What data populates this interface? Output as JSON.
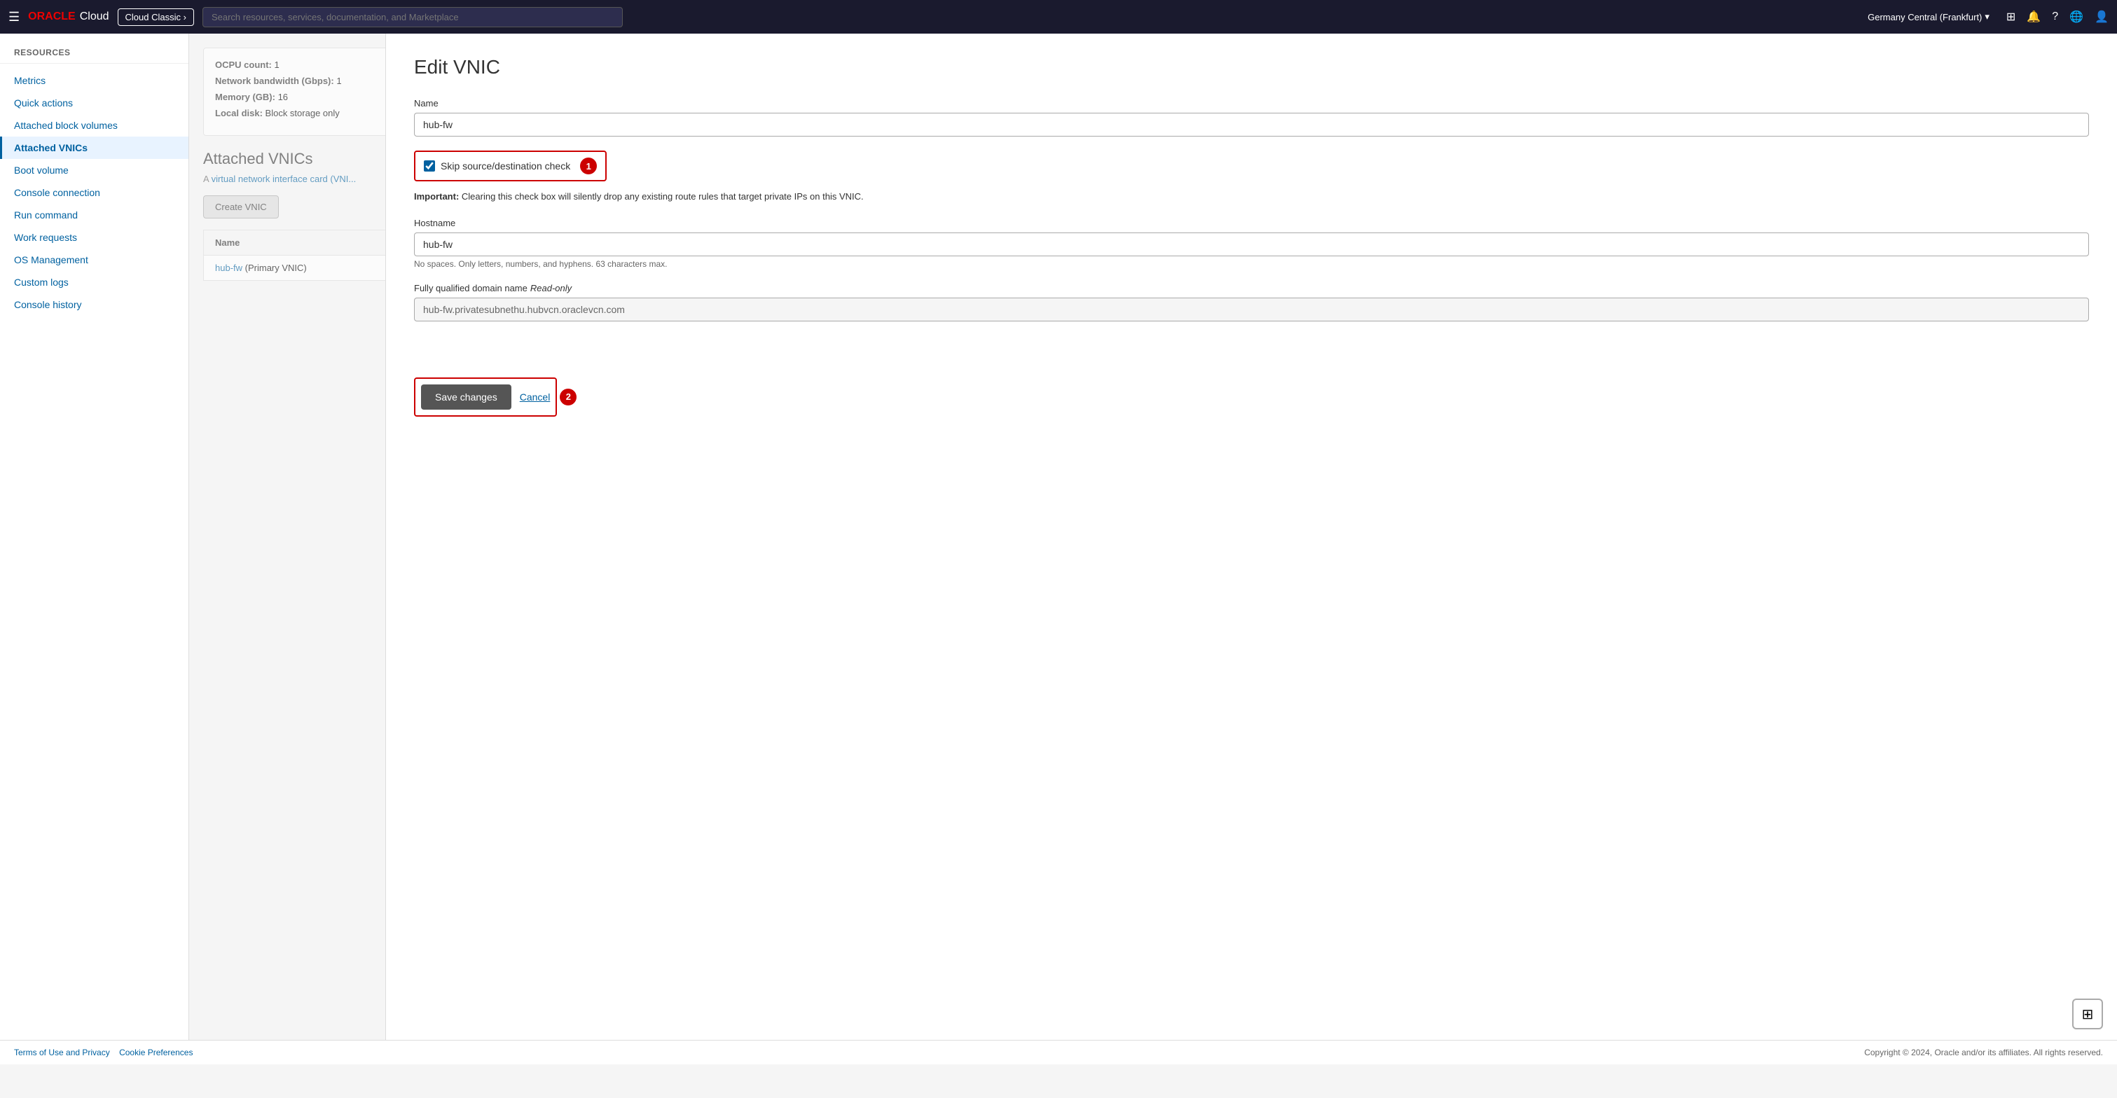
{
  "navbar": {
    "hamburger": "☰",
    "oracle_text": "ORACLE",
    "cloud_text": "Cloud",
    "cloud_classic_label": "Cloud Classic ›",
    "search_placeholder": "Search resources, services, documentation, and Marketplace",
    "region": "Germany Central (Frankfurt)",
    "icons": [
      "⊞",
      "🔔",
      "?",
      "🌐",
      "👤"
    ]
  },
  "sidebar": {
    "section_title": "Resources",
    "items": [
      {
        "id": "metrics",
        "label": "Metrics"
      },
      {
        "id": "quick-actions",
        "label": "Quick actions"
      },
      {
        "id": "attached-block-volumes",
        "label": "Attached block volumes"
      },
      {
        "id": "attached-vnics",
        "label": "Attached VNICs",
        "active": true
      },
      {
        "id": "boot-volume",
        "label": "Boot volume"
      },
      {
        "id": "console-connection",
        "label": "Console connection"
      },
      {
        "id": "run-command",
        "label": "Run command"
      },
      {
        "id": "work-requests",
        "label": "Work requests"
      },
      {
        "id": "os-management",
        "label": "OS Management"
      },
      {
        "id": "custom-logs",
        "label": "Custom logs"
      },
      {
        "id": "console-history",
        "label": "Console history"
      }
    ]
  },
  "bg_content": {
    "info_rows": [
      {
        "label": "OCPU count:",
        "value": "1"
      },
      {
        "label": "Network bandwidth (Gbps):",
        "value": "1"
      },
      {
        "label": "Memory (GB):",
        "value": "16"
      },
      {
        "label": "Local disk:",
        "value": "Block storage only"
      }
    ],
    "section_title": "Attached VNICs",
    "section_desc_text": "A ",
    "section_desc_link": "virtual network interface card (VNI...",
    "create_vnic_label": "Create VNIC",
    "table_header": "Name",
    "table_row_link": "hub-fw",
    "table_row_suffix": " (Primary VNIC)"
  },
  "modal": {
    "title": "Edit VNIC",
    "name_label": "Name",
    "name_value": "hub-fw",
    "checkbox_label": "Skip source/destination check",
    "checkbox_checked": true,
    "badge_1": "1",
    "important_label": "Important:",
    "important_text": "Clearing this check box will silently drop any existing route rules that target private IPs on this VNIC.",
    "hostname_label": "Hostname",
    "hostname_value": "hub-fw",
    "hostname_hint": "No spaces. Only letters, numbers, and hyphens. 63 characters max.",
    "fqdn_label": "Fully qualified domain name",
    "fqdn_readonly_label": "Read-only",
    "fqdn_value": "hub-fw.privatesubnethu.hubvcn.oraclevcn.com",
    "save_label": "Save changes",
    "cancel_label": "Cancel",
    "badge_2": "2"
  },
  "footer": {
    "left_links": [
      "Terms of Use and Privacy",
      "Cookie Preferences"
    ],
    "right_text": "Copyright © 2024, Oracle and/or its affiliates. All rights reserved."
  }
}
